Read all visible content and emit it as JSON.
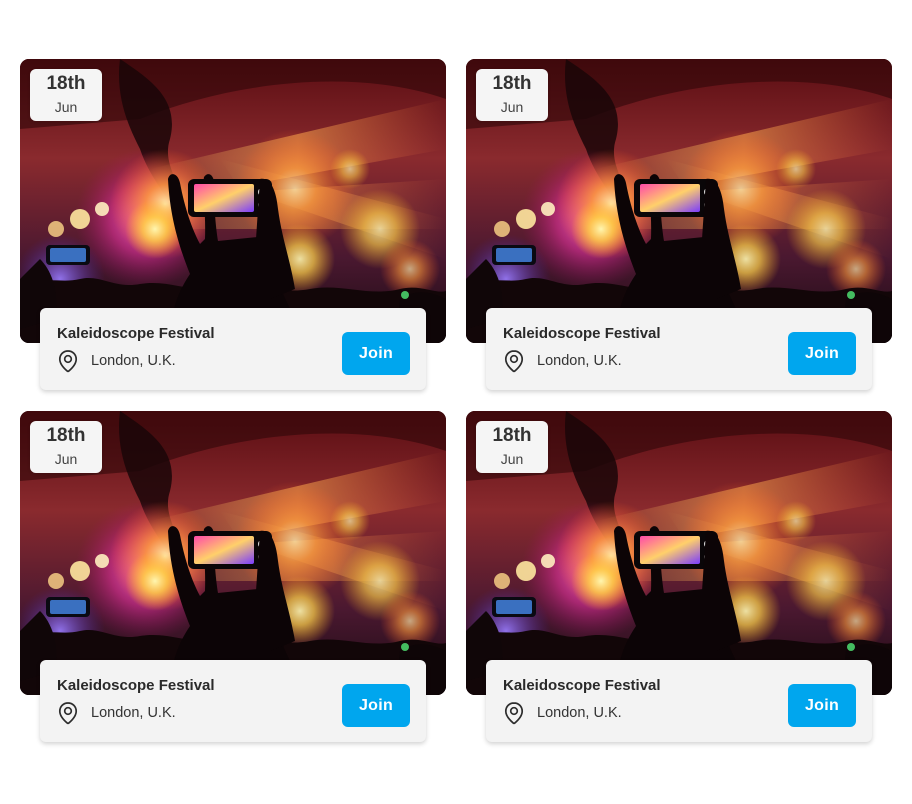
{
  "events": [
    {
      "day": "18th",
      "month": "Jun",
      "title": "Kaleidoscope Festival",
      "location": "London, U.K.",
      "button_label": "Join"
    },
    {
      "day": "18th",
      "month": "Jun",
      "title": "Kaleidoscope Festival",
      "location": "London, U.K.",
      "button_label": "Join"
    },
    {
      "day": "18th",
      "month": "Jun",
      "title": "Kaleidoscope Festival",
      "location": "London, U.K.",
      "button_label": "Join"
    },
    {
      "day": "18th",
      "month": "Jun",
      "title": "Kaleidoscope Festival",
      "location": "London, U.K.",
      "button_label": "Join"
    }
  ],
  "icons": {
    "location": "map-pin-icon"
  },
  "colors": {
    "accent": "#00a6ee",
    "panel_background": "#f3f3f3",
    "badge_background": "#f5f5f5",
    "text_primary": "#2a2a2a"
  }
}
